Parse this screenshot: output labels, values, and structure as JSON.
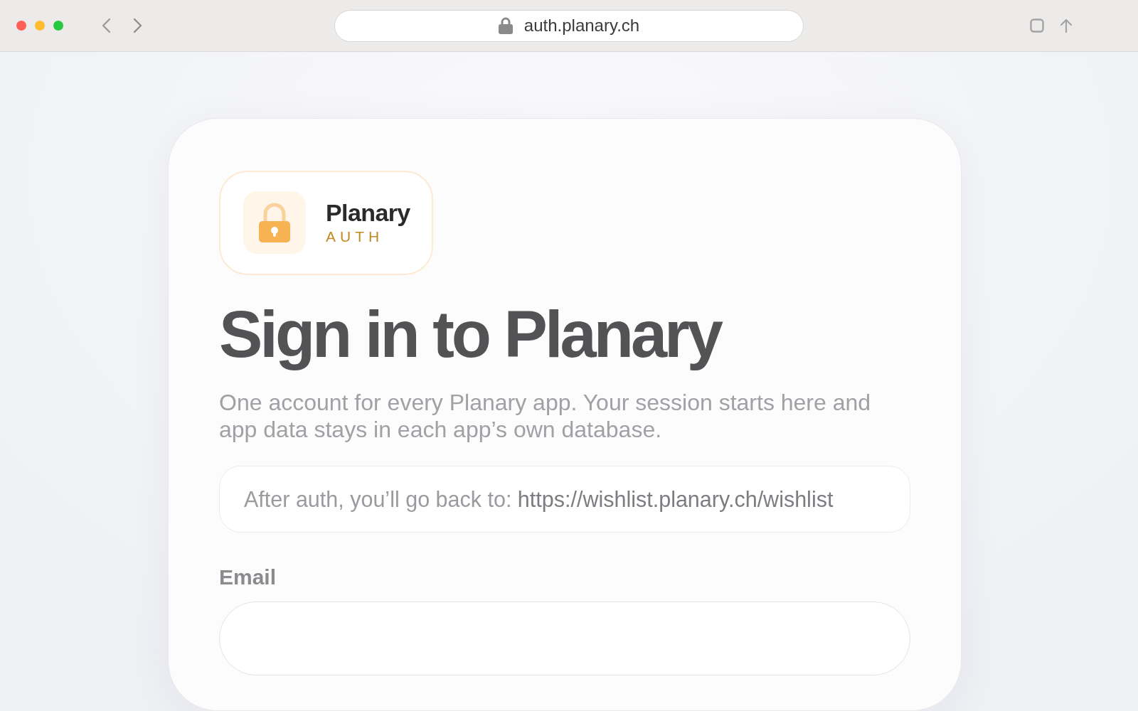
{
  "browser": {
    "address": "auth.planary.ch"
  },
  "brand": {
    "name": "Planary",
    "subtitle": "AUTH"
  },
  "heading": "Sign in to Planary",
  "intro": "One account for every Planary app. Your session starts here and app data stays in each app’s own database.",
  "redirect_notice": {
    "label": "After auth, you’ll go back to:",
    "url": "https://wishlist.planary.ch/wishlist"
  },
  "form": {
    "fields": [
      {
        "label": "Email",
        "kind": "input"
      }
    ]
  }
}
